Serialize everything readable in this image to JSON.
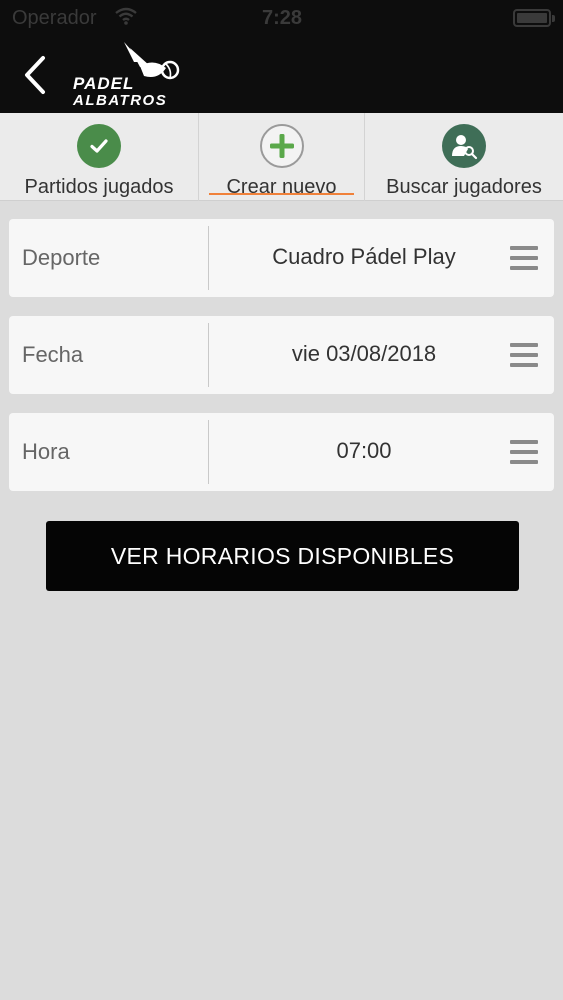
{
  "statusbar": {
    "carrier": "Operador",
    "time": "7:28"
  },
  "header": {
    "logo_line1": "PADEL",
    "logo_line2": "ALBATROS",
    "back_icon": "chevron-left-icon"
  },
  "tabs": [
    {
      "label": "Partidos jugados",
      "icon": "checkmark-icon",
      "icon_color": "#4a8c4a",
      "active": false
    },
    {
      "label": "Crear nuevo",
      "icon": "plus-icon",
      "icon_color": "#5aa84a",
      "active": true
    },
    {
      "label": "Buscar jugadores",
      "icon": "user-search-icon",
      "icon_color": "#3f6e57",
      "active": false
    }
  ],
  "form": {
    "rows": [
      {
        "label": "Deporte",
        "value": "Cuadro Pádel Play"
      },
      {
        "label": "Fecha",
        "value": "vie 03/08/2018"
      },
      {
        "label": "Hora",
        "value": "07:00"
      }
    ]
  },
  "cta_label": "VER HORARIOS DISPONIBLES",
  "colors": {
    "accent": "#f0813a",
    "header_bg": "#0d0d0d",
    "page_bg": "#dcdcdc"
  }
}
